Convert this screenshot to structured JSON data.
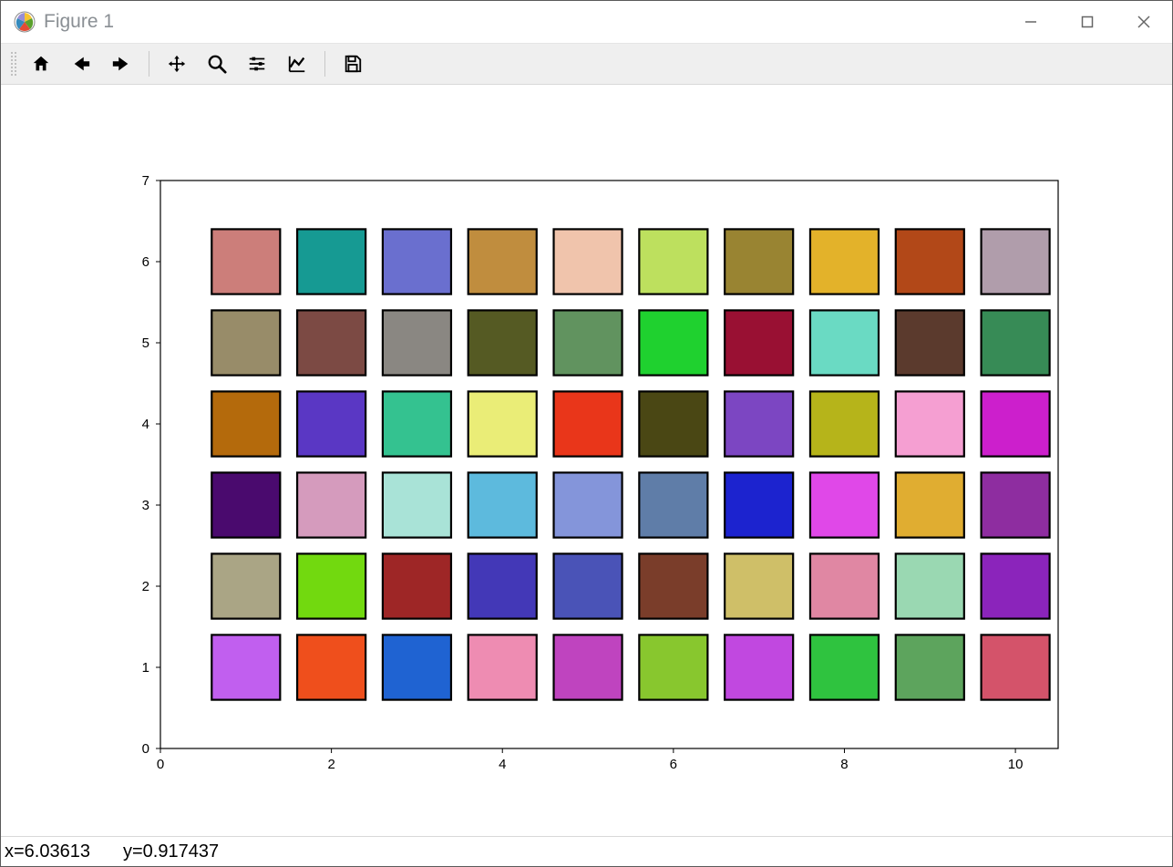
{
  "window": {
    "title": "Figure 1"
  },
  "toolbar": {
    "home": "Home",
    "back": "Back",
    "forward": "Forward",
    "pan": "Pan",
    "zoom": "Zoom",
    "subplots": "Configure subplots",
    "axes": "Edit axis",
    "save": "Save"
  },
  "status": {
    "x_label": "x=6.03613",
    "y_label": "y=0.917437"
  },
  "chart_data": {
    "type": "scatter",
    "xlabel": "",
    "ylabel": "",
    "xlim": [
      0,
      10.5
    ],
    "ylim": [
      0,
      7
    ],
    "xticks": [
      0,
      2,
      4,
      6,
      8,
      10
    ],
    "yticks": [
      0,
      1,
      2,
      3,
      4,
      5,
      6,
      7
    ],
    "element_shape": "square",
    "element_size": 0.8,
    "edge_color": "#000000",
    "rows_from_bottom": [
      {
        "y": 1,
        "colors": [
          "#c15fef",
          "#ef4f1c",
          "#1f63d2",
          "#ee8cb2",
          "#bf44bf",
          "#88c72e",
          "#c148e0",
          "#2fc33f",
          "#5da45d",
          "#d4536a"
        ]
      },
      {
        "y": 2,
        "colors": [
          "#aaa585",
          "#72d90f",
          "#9e2626",
          "#4338b7",
          "#4a53b7",
          "#7a3d2a",
          "#cfbf68",
          "#e087a3",
          "#9ad8b2",
          "#8b24bb"
        ]
      },
      {
        "y": 3,
        "colors": [
          "#4a0a6e",
          "#d59bbd",
          "#a9e3d7",
          "#5dbadd",
          "#8495da",
          "#5f7da8",
          "#1c23cf",
          "#e048e8",
          "#e0ad31",
          "#8e2da0"
        ]
      },
      {
        "y": 4,
        "colors": [
          "#b46a0c",
          "#5a37c4",
          "#34c290",
          "#eaed77",
          "#e9361a",
          "#4a4714",
          "#7c46c2",
          "#b6b41a",
          "#f59fd2",
          "#cc1fcc"
        ]
      },
      {
        "y": 5,
        "colors": [
          "#988c69",
          "#7c4a44",
          "#8a8782",
          "#555a23",
          "#61935f",
          "#1fd12f",
          "#991033",
          "#6adac3",
          "#5b3a2d",
          "#378b56"
        ]
      },
      {
        "y": 6,
        "colors": [
          "#cc7e7a",
          "#169a93",
          "#6a6fcf",
          "#c08d3e",
          "#f0c4ac",
          "#bde05e",
          "#998432",
          "#e3b22a",
          "#b24818",
          "#b09dab"
        ]
      }
    ]
  }
}
